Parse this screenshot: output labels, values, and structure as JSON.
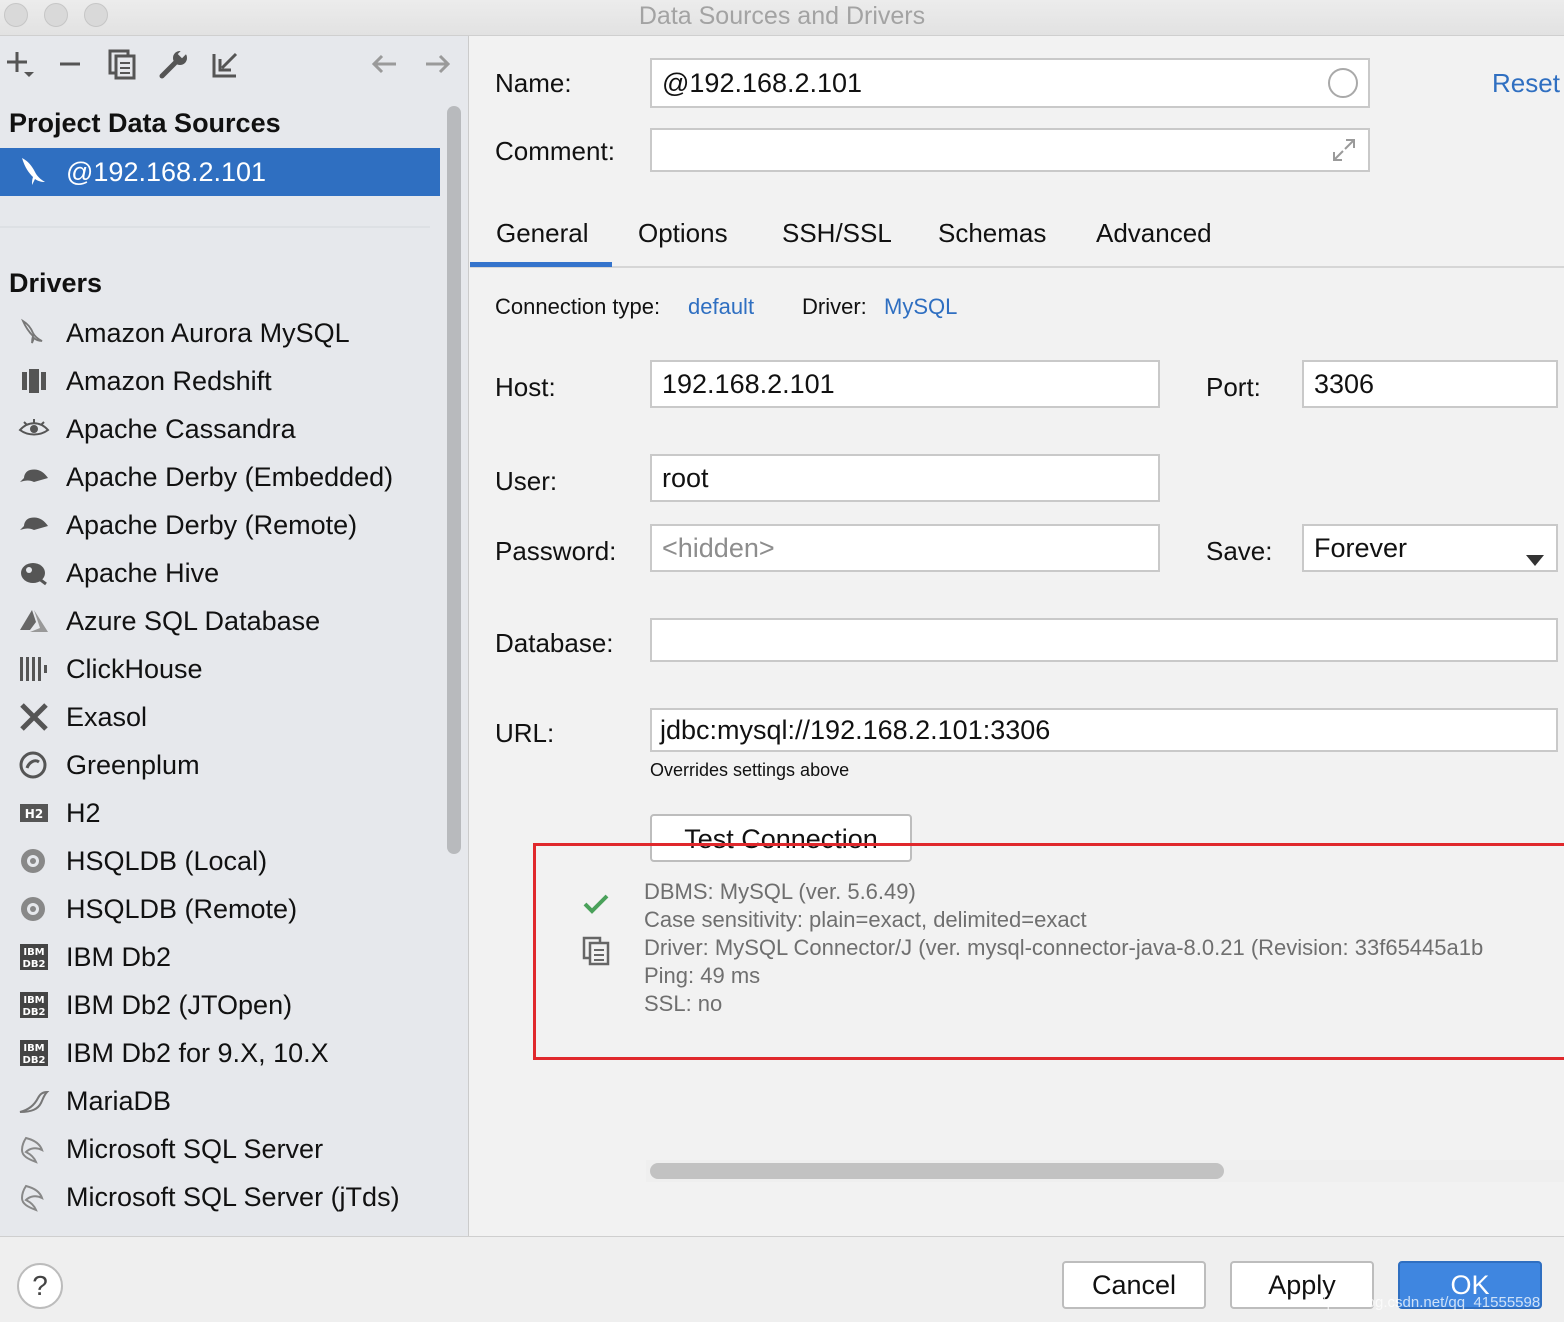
{
  "window": {
    "title": "Data Sources and Drivers"
  },
  "left": {
    "project_section_title": "Project Data Sources",
    "selected_datasource": "@192.168.2.101",
    "drivers_section_title": "Drivers",
    "drivers": [
      {
        "label": "Amazon Aurora MySQL",
        "icon": "dolphin-icon"
      },
      {
        "label": "Amazon Redshift",
        "icon": "redshift-icon"
      },
      {
        "label": "Apache Cassandra",
        "icon": "eye-icon"
      },
      {
        "label": "Apache Derby (Embedded)",
        "icon": "hat-icon"
      },
      {
        "label": "Apache Derby (Remote)",
        "icon": "hat-icon"
      },
      {
        "label": "Apache Hive",
        "icon": "bee-icon"
      },
      {
        "label": "Azure SQL Database",
        "icon": "azure-icon"
      },
      {
        "label": "ClickHouse",
        "icon": "bars-icon"
      },
      {
        "label": "Exasol",
        "icon": "x-icon"
      },
      {
        "label": "Greenplum",
        "icon": "circle-icon"
      },
      {
        "label": "H2",
        "icon": "h2-icon"
      },
      {
        "label": "HSQLDB (Local)",
        "icon": "hsqldb-icon"
      },
      {
        "label": "HSQLDB (Remote)",
        "icon": "hsqldb-icon"
      },
      {
        "label": "IBM Db2",
        "icon": "ibm-db2-icon"
      },
      {
        "label": "IBM Db2 (JTOpen)",
        "icon": "ibm-db2-icon"
      },
      {
        "label": "IBM Db2 for 9.X, 10.X",
        "icon": "ibm-db2-icon"
      },
      {
        "label": "MariaDB",
        "icon": "seal-icon"
      },
      {
        "label": "Microsoft SQL Server",
        "icon": "sqlserver-icon"
      },
      {
        "label": "Microsoft SQL Server (jTds)",
        "icon": "sqlserver-icon"
      }
    ]
  },
  "form": {
    "name_label": "Name:",
    "name_value": "@192.168.2.101",
    "reset_label": "Reset",
    "comment_label": "Comment:",
    "comment_value": "",
    "tabs": [
      "General",
      "Options",
      "SSH/SSL",
      "Schemas",
      "Advanced"
    ],
    "connection_type_label": "Connection type:",
    "connection_type_value": "default",
    "driver_label": "Driver:",
    "driver_value": "MySQL",
    "host_label": "Host:",
    "host_value": "192.168.2.101",
    "port_label": "Port:",
    "port_value": "3306",
    "user_label": "User:",
    "user_value": "root",
    "password_label": "Password:",
    "password_placeholder": "<hidden>",
    "save_label": "Save:",
    "save_value": "Forever",
    "database_label": "Database:",
    "database_value": "",
    "url_label": "URL:",
    "url_value": "jdbc:mysql://192.168.2.101:3306",
    "url_hint": "Overrides settings above",
    "test_connection_label": "Test Connection"
  },
  "result": {
    "lines": [
      "DBMS: MySQL (ver. 5.6.49)",
      "Case sensitivity: plain=exact, delimited=exact",
      "Driver: MySQL Connector/J (ver. mysql-connector-java-8.0.21 (Revision: 33f65445a1b",
      "Ping: 49 ms",
      "SSL: no"
    ],
    "status_color": "#4aa15a",
    "highlight_color": "#e0282c"
  },
  "footer": {
    "help_label": "?",
    "cancel_label": "Cancel",
    "apply_label": "Apply",
    "ok_label": "OK",
    "watermark": "https://blog.csdn.net/qq_41555598"
  },
  "colors": {
    "accent": "#2f6fc1",
    "selection": "#2f6fc1"
  }
}
